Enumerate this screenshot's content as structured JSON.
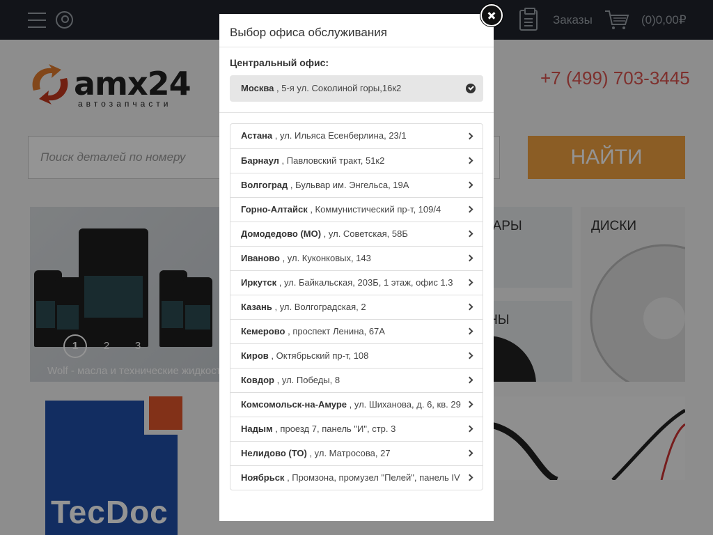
{
  "header": {
    "orders_label": "Заказы",
    "cart_total": "(0)0,00₽"
  },
  "logo": {
    "brand": "amx24",
    "tagline": "автозапчасти"
  },
  "phone": "+7 (499) 703-3445",
  "search": {
    "placeholder": "Поиск деталей по номеру",
    "button_label": "НАЙТИ"
  },
  "banner": {
    "caption": "Wolf - масла и технические жидкости",
    "slides": [
      "1",
      "2",
      "3"
    ],
    "active_slide": "1"
  },
  "tiles": {
    "accessories": "АКСЕССУАРЫ",
    "tires": "ШИНЫ",
    "disks": "ДИСКИ"
  },
  "tecdoc_label": "TecDoc",
  "modal": {
    "title": "Выбор офиса обслуживания",
    "central_label": "Центральный офис:",
    "central_office": {
      "city": "Москва",
      "address": " , 5-я ул. Соколиной горы,16к2"
    },
    "offices": [
      {
        "city": "Астана",
        "address": " , ул. Ильяса Есенберлина, 23/1"
      },
      {
        "city": "Барнаул",
        "address": " , Павловский тракт, 51к2"
      },
      {
        "city": "Волгоград",
        "address": " , Бульвар им. Энгельса, 19А"
      },
      {
        "city": "Горно-Алтайск",
        "address": " , Коммунистический пр-т, 109/4"
      },
      {
        "city": "Домодедово (МО)",
        "address": " , ул. Советская, 58Б"
      },
      {
        "city": "Иваново",
        "address": " , ул. Куконковых, 143"
      },
      {
        "city": "Иркутск",
        "address": " , ул. Байкальская, 203Б, 1 этаж, офис 1.3"
      },
      {
        "city": "Казань",
        "address": " , ул. Волгоградская, 2"
      },
      {
        "city": "Кемерово",
        "address": " , проспект Ленина, 67А"
      },
      {
        "city": "Киров",
        "address": " , Октябрьский пр-т, 108"
      },
      {
        "city": "Ковдор",
        "address": " , ул. Победы, 8"
      },
      {
        "city": "Комсомольск-на-Амуре",
        "address": " , ул. Шиханова, д. 6, кв. 29"
      },
      {
        "city": "Надым",
        "address": " , проезд 7, панель \"И\", стр. 3"
      },
      {
        "city": "Нелидово (ТО)",
        "address": " , ул. Матросова, 27"
      },
      {
        "city": "Ноябрьск",
        "address": " , Промзона, промузел \"Пелей\", панель IV"
      }
    ]
  }
}
